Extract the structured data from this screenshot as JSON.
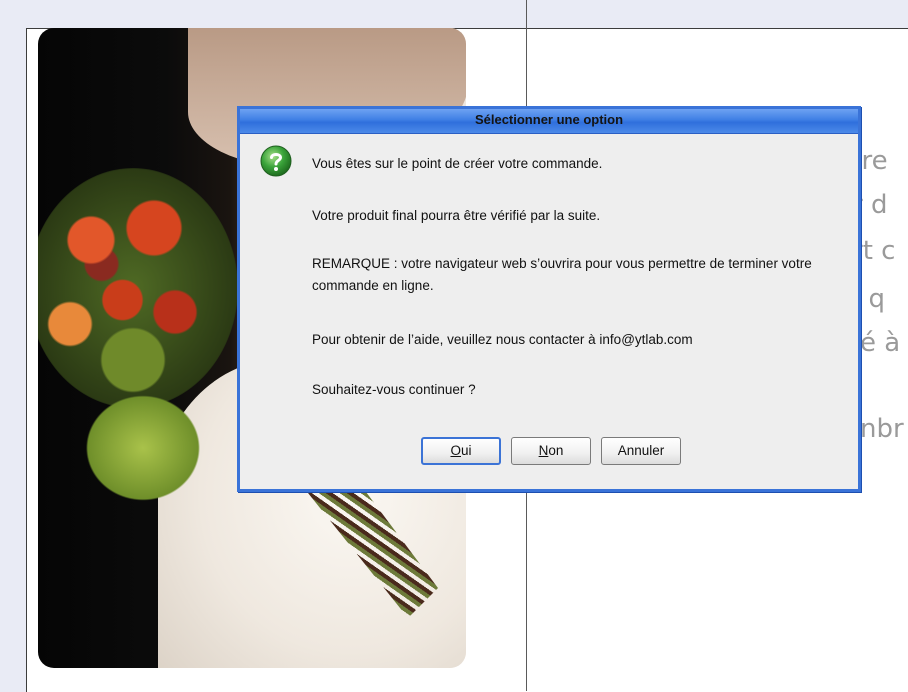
{
  "dialog": {
    "title": "Sélectionner une option",
    "lines": [
      "Vous êtes sur le point de créer votre commande.",
      "Votre produit final pourra être vérifié par la suite.",
      "REMARQUE : votre navigateur web s’ouvrira pour vous permettre de terminer votre commande en ligne.",
      "Pour obtenir de l’aide, veuillez nous contacter à info@ytlab.com",
      "Souhaitez-vous continuer ?"
    ],
    "buttons": {
      "oui_mnemonic": "O",
      "oui_rest": "ui",
      "non_mnemonic": "N",
      "non_rest": "on",
      "annuler": "Annuler"
    },
    "icon": "question-icon"
  },
  "background_text": [
    "ure",
    "r d",
    "rt c",
    ", q",
    "é à",
    "nbr"
  ],
  "colors": {
    "dialog_border": "#3a73d8",
    "title_gradient_top": "#6ea2f2",
    "question_icon": "#3aa33a"
  }
}
